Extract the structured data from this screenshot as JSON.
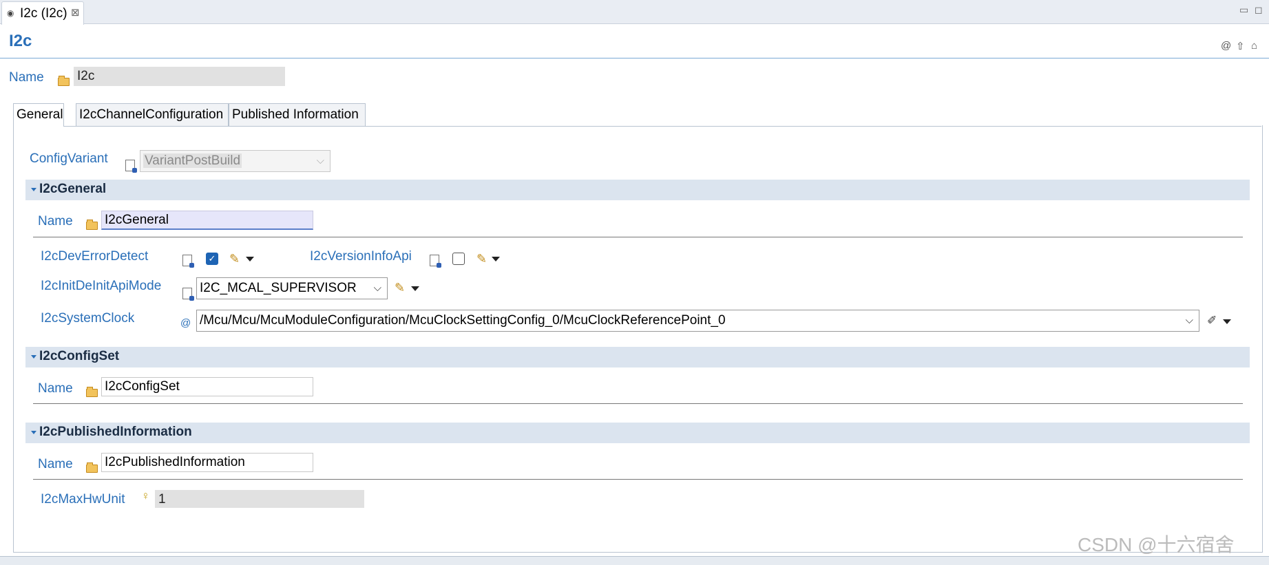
{
  "editor_tab": {
    "label": "I2c (I2c)",
    "close": "⊠"
  },
  "window_buttons": {
    "minimize": "▭",
    "maximize": "◻"
  },
  "page_title": "I2c",
  "header": {
    "name_label": "Name",
    "name_value": "I2c"
  },
  "tabs": [
    {
      "label": "General"
    },
    {
      "label": "I2cChannelConfiguration"
    },
    {
      "label": "Published Information"
    }
  ],
  "general": {
    "config_variant_label": "ConfigVariant",
    "config_variant_value": "VariantPostBuild",
    "i2c_general": {
      "title": "I2cGeneral",
      "name_label": "Name",
      "name_value": "I2cGeneral",
      "dev_error_detect_label": "I2cDevErrorDetect",
      "dev_error_detect_checked": true,
      "version_info_api_label": "I2cVersionInfoApi",
      "version_info_api_checked": false,
      "init_deinit_label": "I2cInitDeInitApiMode",
      "init_deinit_value": "I2C_MCAL_SUPERVISOR",
      "system_clock_label": "I2cSystemClock",
      "system_clock_value": "/Mcu/Mcu/McuModuleConfiguration/McuClockSettingConfig_0/McuClockReferencePoint_0"
    },
    "i2c_config_set": {
      "title": "I2cConfigSet",
      "name_label": "Name",
      "name_value": "I2cConfigSet"
    },
    "i2c_published": {
      "title": "I2cPublishedInformation",
      "name_label": "Name",
      "name_value": "I2cPublishedInformation",
      "max_hw_unit_label": "I2cMaxHwUnit",
      "max_hw_unit_value": "1"
    }
  },
  "watermark": "CSDN @十六宿舍",
  "icons": [
    "editor-icon",
    "folder-icon",
    "variant-doc-icon",
    "pencil-icon",
    "dropdown-caret-icon",
    "reference-icon",
    "bulb-icon",
    "help-icon",
    "up-icon",
    "home-icon"
  ],
  "colors": {
    "label_blue": "#2a6fb8",
    "section_bg": "#dbe4ef",
    "checkbox_checked": "#1e64b4"
  }
}
